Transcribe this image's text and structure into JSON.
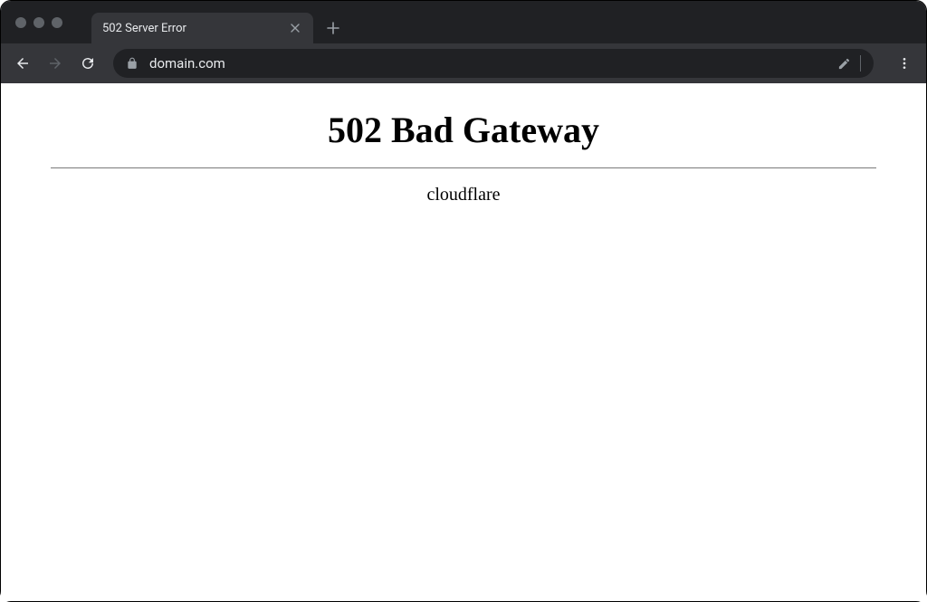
{
  "browser": {
    "tab_title": "502 Server Error",
    "url": "domain.com"
  },
  "page": {
    "heading": "502 Bad Gateway",
    "subtext": "cloudflare"
  }
}
